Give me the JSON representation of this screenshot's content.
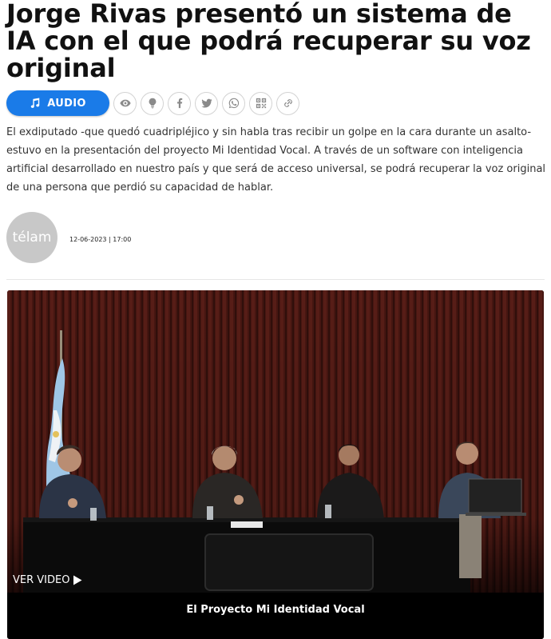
{
  "article": {
    "title": "Jorge Rivas presentó un sistema de IA con el que podrá recuperar su voz original",
    "lead": "El exdiputado -que quedó cuadripléjico y sin habla tras recibir un golpe en la cara durante un asalto- estuvo en la presentación del proyecto Mi Identidad Vocal. A través de un software con inteligencia artificial desarrollado en nuestro país y que será de acceso universal, se podrá recuperar la voz original de una persona que perdió su capacidad de hablar."
  },
  "toolbar": {
    "audio_label": "AUDIO",
    "icons": [
      "eye-icon",
      "lightbulb-icon",
      "facebook-icon",
      "twitter-icon",
      "whatsapp-icon",
      "qr-code-icon",
      "link-icon"
    ]
  },
  "author": {
    "logo_text": "télam",
    "dateline": "12-06-2023 | 17:00"
  },
  "video": {
    "cta": "VER VIDEO",
    "caption": "El Proyecto Mi Identidad Vocal"
  },
  "colors": {
    "accent": "#1a7be8",
    "icon_gray": "#8a8a8a",
    "avatar_bg": "#c8c8c8"
  }
}
